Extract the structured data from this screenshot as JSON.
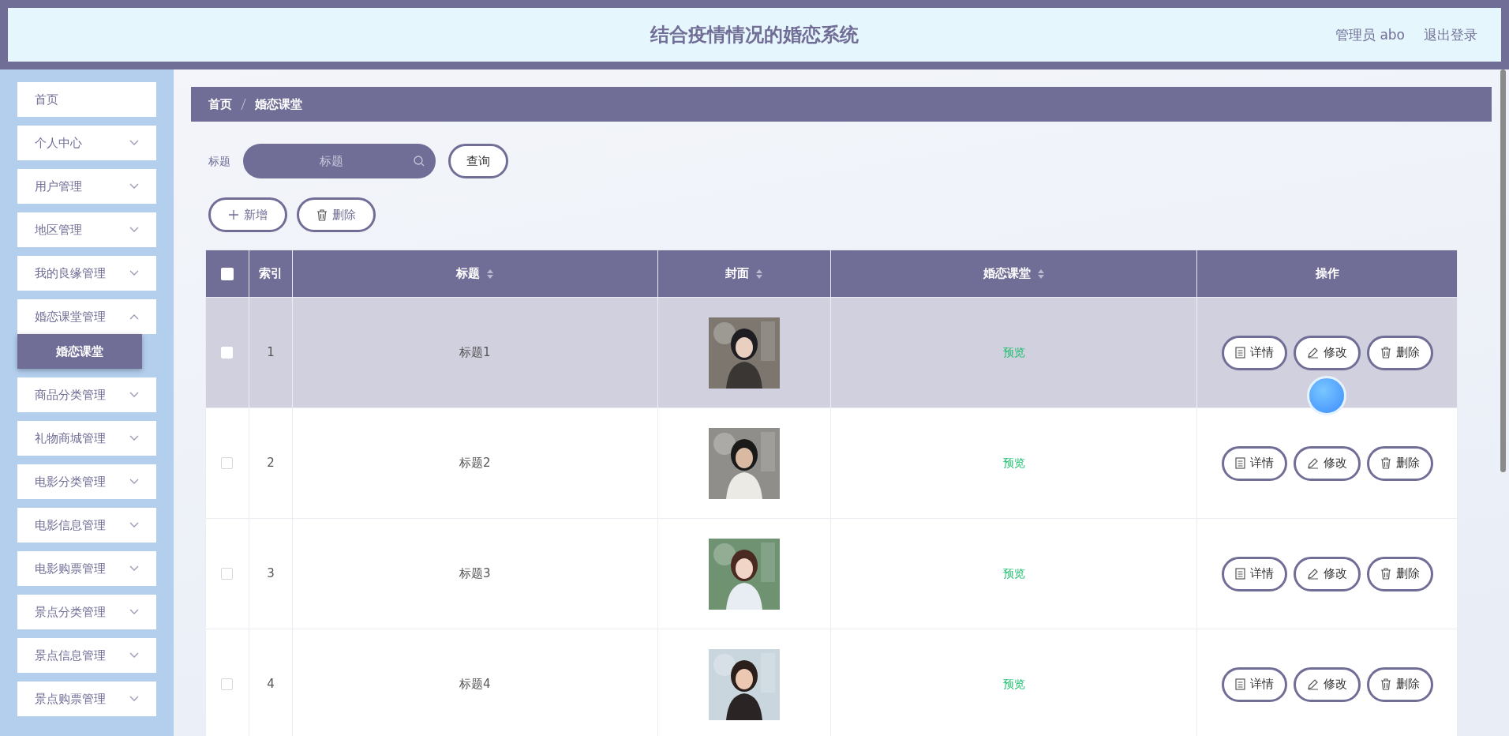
{
  "header": {
    "title": "结合疫情情况的婚恋系统",
    "user": "管理员 abo",
    "logout": "退出登录"
  },
  "sidebar": {
    "items": [
      {
        "label": "首页",
        "expandable": false
      },
      {
        "label": "个人中心",
        "expandable": true,
        "expanded": false
      },
      {
        "label": "用户管理",
        "expandable": true,
        "expanded": false
      },
      {
        "label": "地区管理",
        "expandable": true,
        "expanded": false
      },
      {
        "label": "我的良缘管理",
        "expandable": true,
        "expanded": false
      },
      {
        "label": "婚恋课堂管理",
        "expandable": true,
        "expanded": true,
        "children": [
          {
            "label": "婚恋课堂",
            "selected": true
          }
        ]
      },
      {
        "label": "商品分类管理",
        "expandable": true,
        "expanded": false
      },
      {
        "label": "礼物商城管理",
        "expandable": true,
        "expanded": false
      },
      {
        "label": "电影分类管理",
        "expandable": true,
        "expanded": false
      },
      {
        "label": "电影信息管理",
        "expandable": true,
        "expanded": false
      },
      {
        "label": "电影购票管理",
        "expandable": true,
        "expanded": false
      },
      {
        "label": "景点分类管理",
        "expandable": true,
        "expanded": false
      },
      {
        "label": "景点信息管理",
        "expandable": true,
        "expanded": false
      },
      {
        "label": "景点购票管理",
        "expandable": true,
        "expanded": false
      }
    ]
  },
  "breadcrumb": [
    "首页",
    "婚恋课堂"
  ],
  "search": {
    "label": "标题",
    "placeholder": "标题",
    "button": "查询"
  },
  "actions": [
    {
      "kind": "add",
      "label": "新增"
    },
    {
      "kind": "delete",
      "label": "删除"
    }
  ],
  "table": {
    "columns": [
      {
        "kind": "check",
        "checked": false
      },
      {
        "kind": "text",
        "label": "索引",
        "sortable": false
      },
      {
        "kind": "text",
        "label": "标题",
        "sortable": true
      },
      {
        "kind": "text",
        "label": "封面",
        "sortable": true
      },
      {
        "kind": "text",
        "label": "婚恋课堂",
        "sortable": true
      },
      {
        "kind": "text",
        "label": "操作",
        "sortable": false
      }
    ],
    "rows": [
      {
        "index": "1",
        "title": "标题1",
        "cover": {
          "kind": "picture"
        },
        "link": "预览",
        "checked": false,
        "hovered": true,
        "actions": [
          {
            "kind": "detail",
            "label": "详情"
          },
          {
            "kind": "edit",
            "label": "修改"
          },
          {
            "kind": "delete",
            "label": "删除"
          }
        ]
      },
      {
        "index": "2",
        "title": "标题2",
        "cover": {
          "kind": "picture"
        },
        "link": "预览",
        "checked": false,
        "hovered": false,
        "actions": [
          {
            "kind": "detail",
            "label": "详情"
          },
          {
            "kind": "edit",
            "label": "修改"
          },
          {
            "kind": "delete",
            "label": "删除"
          }
        ]
      },
      {
        "index": "3",
        "title": "标题3",
        "cover": {
          "kind": "picture"
        },
        "link": "预览",
        "checked": false,
        "hovered": false,
        "actions": [
          {
            "kind": "detail",
            "label": "详情"
          },
          {
            "kind": "edit",
            "label": "修改"
          },
          {
            "kind": "delete",
            "label": "删除"
          }
        ]
      },
      {
        "index": "4",
        "title": "标题4",
        "cover": {
          "kind": "picture"
        },
        "link": "预览",
        "checked": false,
        "hovered": false,
        "actions": [
          {
            "kind": "detail",
            "label": "详情"
          },
          {
            "kind": "edit",
            "label": "修改"
          },
          {
            "kind": "delete",
            "label": "删除"
          }
        ]
      }
    ]
  }
}
